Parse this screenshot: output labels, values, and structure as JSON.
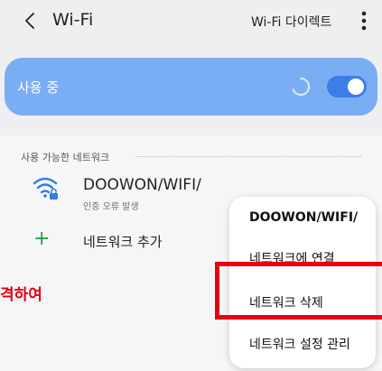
{
  "header": {
    "title": "Wi-Fi",
    "wifi_direct_label": "Wi-Fi 다이렉트",
    "back_icon": "chevron-left-icon",
    "more_icon": "more-vertical-icon"
  },
  "usage_card": {
    "label": "사용 중",
    "toggle_state": "on",
    "card_color": "#7aaef4",
    "toggle_color": "#3d7de8"
  },
  "networks": {
    "section_title": "사용 가능한 네트워크",
    "items": [
      {
        "ssid": "DOOWON/WIFI/",
        "status": "인증 오류 발생",
        "icon": "wifi-lock-icon"
      }
    ],
    "add_label": "네트워크 추가",
    "add_icon": "plus-icon"
  },
  "context_menu": {
    "title": "DOOWON/WIFI/",
    "items": [
      {
        "label": "네트워크에 연결"
      },
      {
        "label": "네트워크 삭제"
      },
      {
        "label": "네트워크 설정 관리"
      }
    ]
  },
  "annotation": {
    "text": "격하여",
    "color": "#e60012"
  }
}
